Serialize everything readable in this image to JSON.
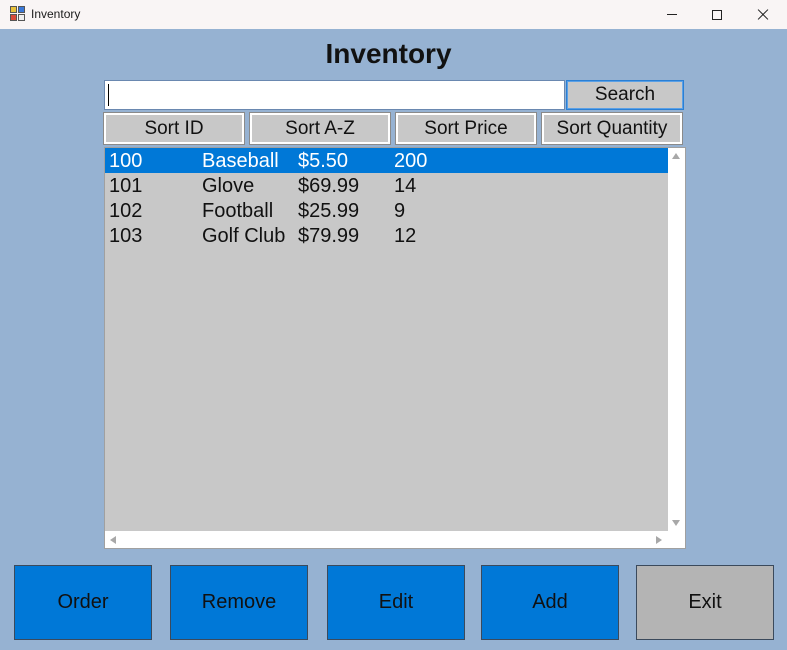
{
  "window": {
    "title": "Inventory",
    "icon": "app-grid-icon",
    "controls": [
      "minimize-icon",
      "maximize-icon",
      "close-icon"
    ]
  },
  "heading": "Inventory",
  "search": {
    "value": "",
    "button_label": "Search"
  },
  "sort_buttons": [
    "Sort ID",
    "Sort A-Z",
    "Sort Price",
    "Sort Quantity"
  ],
  "items": [
    {
      "id": "100",
      "name": "Baseball",
      "price": "$5.50",
      "quantity": "200",
      "selected": true
    },
    {
      "id": "101",
      "name": "Glove",
      "price": "$69.99",
      "quantity": "14",
      "selected": false
    },
    {
      "id": "102",
      "name": "Football",
      "price": "$25.99",
      "quantity": "9",
      "selected": false
    },
    {
      "id": "103",
      "name": "Golf Club",
      "price": "$79.99",
      "quantity": "12",
      "selected": false
    }
  ],
  "actions": [
    "Order",
    "Remove",
    "Edit",
    "Add",
    "Exit"
  ],
  "colors": {
    "window_bg": "#96b2d2",
    "accent_blue": "#0078d7",
    "list_bg": "#c8c8c8",
    "exit_gray": "#b4b4b4"
  }
}
